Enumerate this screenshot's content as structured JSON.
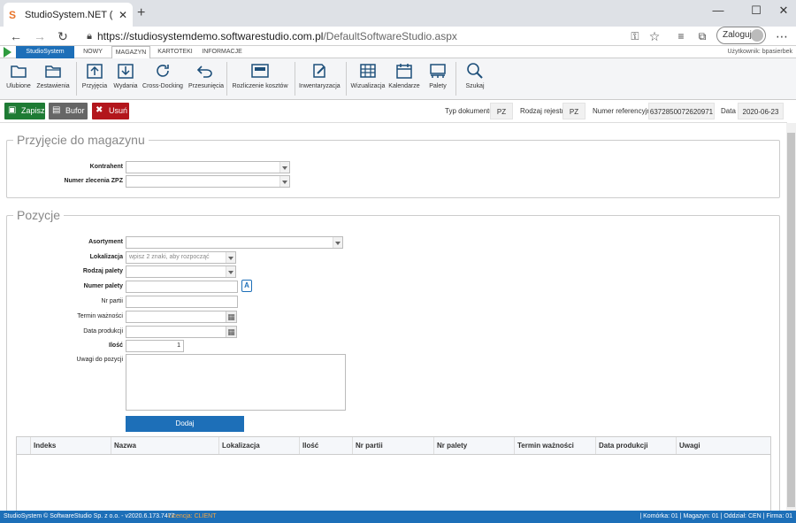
{
  "browser": {
    "tab_title": "StudioSystem.NET (c) SoftwareSt",
    "url_host": "https://studiosystemdemo.softwarestudio.com.pl",
    "url_path": "/DefaultSoftwareStudio.aspx",
    "login_label": "Zaloguj"
  },
  "app": {
    "brand": "StudioSystem",
    "menu_tabs": [
      "NOWY",
      "MAGAZYN",
      "KARTOTEKI",
      "INFORMACJE"
    ],
    "active_tab": "MAGAZYN",
    "user_label": "Użytkownik: bpasierbek"
  },
  "ribbon": [
    {
      "label": "Ulubione",
      "icon": "folder-open-icon"
    },
    {
      "label": "Zestawienia",
      "icon": "folder-icon"
    },
    {
      "label": "Przyjęcia",
      "icon": "arrow-up-box-icon"
    },
    {
      "label": "Wydania",
      "icon": "arrow-down-box-icon"
    },
    {
      "label": "Cross-Docking",
      "icon": "refresh-icon"
    },
    {
      "label": "Przesunięcia",
      "icon": "undo-arrow-icon"
    },
    {
      "label": "Rozliczenie kosztów",
      "icon": "calculator-icon"
    },
    {
      "label": "Inwentaryzacja",
      "icon": "edit-document-icon"
    },
    {
      "label": "Wizualizacja",
      "icon": "grid-view-icon"
    },
    {
      "label": "Kalendarze",
      "icon": "calendar-icon"
    },
    {
      "label": "Palety",
      "icon": "pallet-icon"
    },
    {
      "label": "Szukaj",
      "icon": "search-icon"
    }
  ],
  "toolbar": {
    "save_label": "Zapisz",
    "buffer_label": "Bufor",
    "delete_label": "Usuń",
    "doc_type_label": "Typ dokumentu",
    "doc_type_value": "PZ",
    "register_label": "Rodzaj rejestru",
    "register_value": "PZ",
    "ref_label": "Numer referencyjny",
    "ref_value": "637285007262097​1",
    "date_label": "Data",
    "date_value": "2020-06-23"
  },
  "header_section": {
    "legend": "Przyjęcie do magazynu",
    "kontrahent_label": "Kontrahent",
    "zlecenie_label": "Numer zlecenia ZPZ"
  },
  "positions_section": {
    "legend": "Pozycje",
    "asortyment_label": "Asortyment",
    "lokalizacja_label": "Lokalizacja",
    "lokalizacja_placeholder": "wpisz 2 znaki, aby rozpocząć",
    "rodzaj_palety_label": "Rodzaj palety",
    "numer_palety_label": "Numer palety",
    "nr_partii_label": "Nr partii",
    "termin_label": "Termin ważności",
    "data_produkcji_label": "Data produkcji",
    "ilosc_label": "Ilość",
    "ilosc_value": "1",
    "uwagi_label": "Uwagi do pozycji",
    "add_label": "Dodaj"
  },
  "grid": {
    "columns": [
      "Indeks",
      "Nazwa",
      "Lokalizacja",
      "Ilość",
      "Nr partii",
      "Nr palety",
      "Termin ważności",
      "Data produkcji",
      "Uwagi"
    ]
  },
  "status": {
    "copyright": "StudioSystem © SoftwareStudio Sp. z o.o. - v2020.6.173.7477",
    "license": "Licencja: CLIENT",
    "right": "| Komórka: 01 | Magazyn: 01 | Oddział: CEN | Firma: 01"
  },
  "colors": {
    "brand_blue": "#1d6fb8",
    "save_green": "#1e7b34",
    "buffer_gray": "#666666",
    "delete_red": "#b3161c"
  }
}
